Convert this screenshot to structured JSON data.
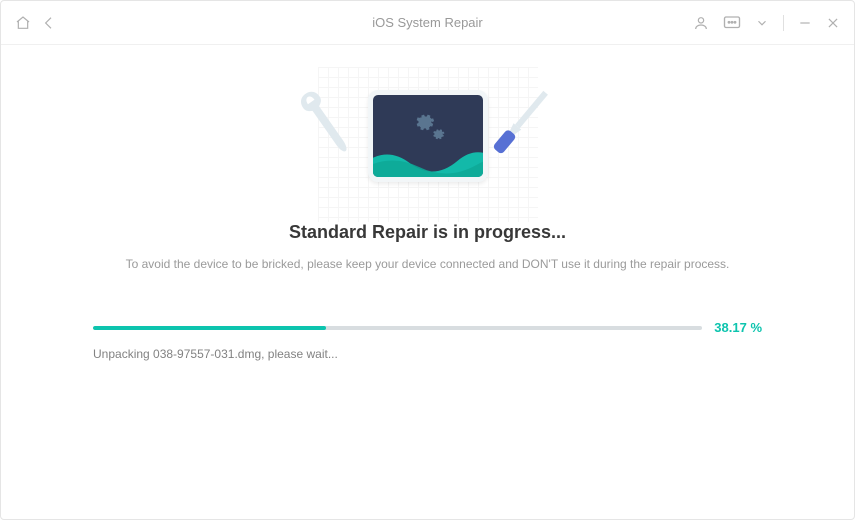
{
  "titlebar": {
    "title": "iOS System Repair"
  },
  "content": {
    "heading": "Standard Repair is in progress...",
    "subtext": "To avoid the device to be bricked, please keep your device connected and DON'T use it during the repair process."
  },
  "progress": {
    "value": 38.17,
    "percent_label": "38.17 %",
    "fill_width": "38.17%",
    "status": "Unpacking 038-97557-031.dmg, please wait..."
  }
}
